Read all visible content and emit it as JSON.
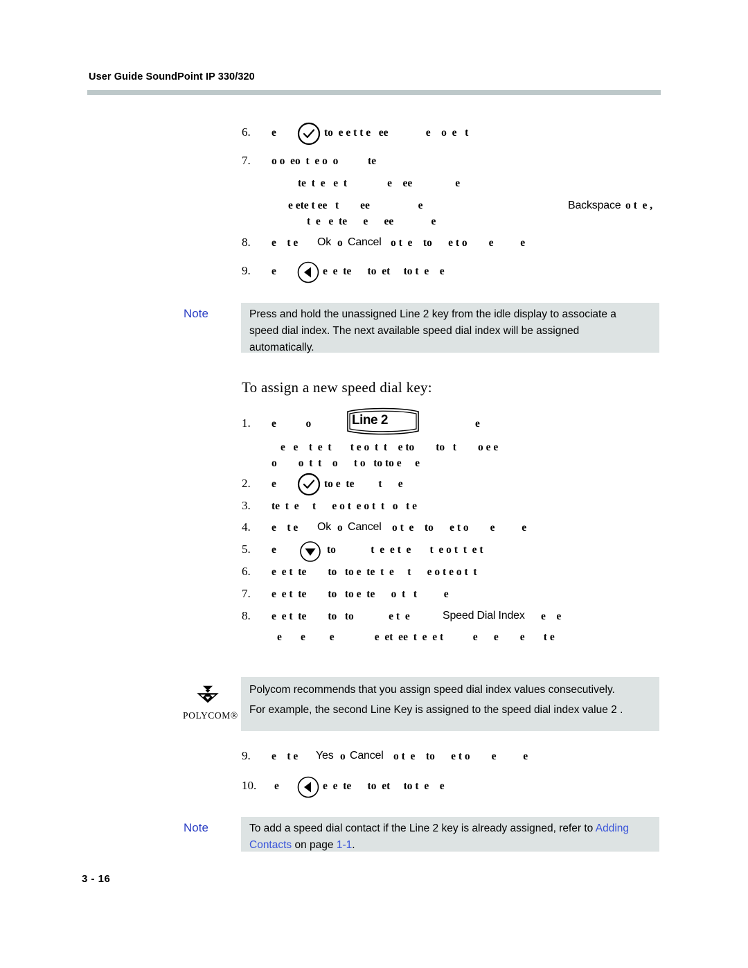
{
  "page": {
    "header_title": "User Guide SoundPoint IP 330/320",
    "footer": "3 - 16"
  },
  "section_heading": "To assign a new speed dial key:",
  "procedure_top": {
    "steps": [
      {
        "number": "6.",
        "icon": "checkmark-circle-icon",
        "before_icon": "e",
        "after_icon": "to  e e t t e   ee              e    o  e   t"
      },
      {
        "number": "7.",
        "icon": null,
        "text": "o o  eo  t  e o  o           te",
        "sub_lines": [
          "te  t  e   e  t               e    ee                e",
          "e ete t ee   t        ee                  e",
          "t  e   e  te      e      ee              e"
        ],
        "sub_ui_token": "Backspace",
        "sub_ui_tail": "o t  e ,"
      },
      {
        "number": "8.",
        "icon": null,
        "before_ui": "e    t e",
        "ui_token_1": "Ok",
        "mid_ui": "o",
        "ui_token_2": "Cancel",
        "after_ui": "o t  e    to      e t o        e          e"
      },
      {
        "number": "9.",
        "icon": "left-arrow-circle-icon",
        "before_icon": "e",
        "after_icon": "e  e  te      to  et     to t  e    e"
      }
    ]
  },
  "procedure_bottom": {
    "steps": [
      {
        "number": "1.",
        "icon": "line-key-graphic",
        "before_icon": "e           o",
        "after_icon": "e",
        "sub_lines": [
          "e   e    t  e  t       t e o  t  t    e to        to   t        o e e",
          "o        o  t  t    o      t o   to to e     e"
        ]
      },
      {
        "number": "2.",
        "icon": "checkmark-circle-icon",
        "before_icon": "e",
        "after_icon": "to e  te         t      e"
      },
      {
        "number": "3.",
        "icon": null,
        "text": "te  t  e     t      e o t  e o t  t   o   t e"
      },
      {
        "number": "4.",
        "icon": null,
        "before_ui": "e    t e",
        "ui_token_1": "Ok",
        "mid_ui": "o",
        "ui_token_2": "Cancel",
        "after_ui": "o t  e    to      e t o        e          e"
      },
      {
        "number": "5.",
        "icon": "down-arrow-circle-icon",
        "before_icon": "e",
        "after_icon": "to             t  e  e t  e       t  e o t  t  e t"
      },
      {
        "number": "6.",
        "icon": null,
        "text": "e  e t  te        to   to e  te  t  e     t      e o t e o t  t"
      },
      {
        "number": "7.",
        "icon": null,
        "text": "e  e t  te        to   to e  te      o  t   t          e"
      },
      {
        "number": "8.",
        "icon": null,
        "before_ui": "e  e t  te        to   to             e t  e",
        "ui_token_1": "Speed Dial Index",
        "after_ui": "e    e",
        "sub_lines": [
          "e       e         e               e  et  ee  t  e  e t           e      e        e       t e"
        ]
      },
      {
        "number": "9.",
        "icon": null,
        "before_ui": "e    t e",
        "ui_token_1": "Yes",
        "mid_ui": "o",
        "ui_token_2": "Cancel",
        "after_ui": "o t  e    to      e t o        e          e"
      },
      {
        "number": "10.",
        "icon": "left-arrow-circle-icon",
        "before_icon": "e",
        "after_icon": "e  e  te      to  et     to t  e    e"
      }
    ]
  },
  "line_key_graphic": {
    "label": "Line 2"
  },
  "callouts": {
    "note_top": {
      "label": "Note",
      "text": "Press and hold the unassigned Line 2 key from the idle display to associate a speed dial index. The next available speed dial index will be assigned automatically."
    },
    "tip": {
      "logo_wordmark": "POLYCOM®",
      "line1": "Polycom recommends that you assign speed dial index values consecutively.",
      "line2": "For example, the second Line Key is assigned to the speed dial index value  2 ."
    },
    "note_bottom": {
      "label": "Note",
      "text_before_link": "To add a speed dial contact if the Line 2 key is already assigned, refer to ",
      "link_text": "Adding Contacts",
      "text_mid": " on page ",
      "link_page": "1-1",
      "text_after": "."
    }
  },
  "colors": {
    "rule_bar": "#bdc8c9",
    "callout_bg": "#dde3e3",
    "note_label": "#2b3fc4",
    "link": "#3a55d9"
  }
}
